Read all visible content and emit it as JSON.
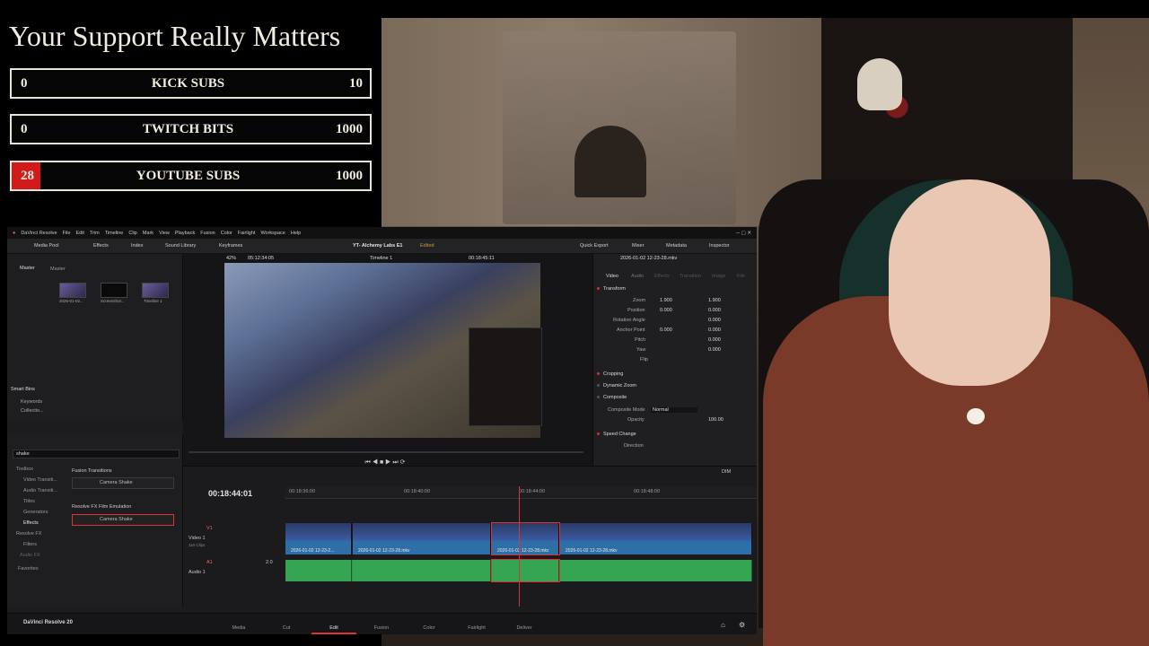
{
  "support": {
    "title": "Your Support Really Matters",
    "accent": "#d11a1a",
    "goals": [
      {
        "current": "0",
        "label": "KICK SUBS",
        "max": "10",
        "progress": 0
      },
      {
        "current": "0",
        "label": "TWITCH BITS",
        "max": "1000",
        "progress": 0
      },
      {
        "current": "28",
        "label": "YOUTUBE SUBS",
        "max": "1000",
        "progress": 0.028
      }
    ]
  },
  "resolve": {
    "menu": [
      "DaVinci Resolve",
      "File",
      "Edit",
      "Trim",
      "Timeline",
      "Clip",
      "Mark",
      "View",
      "Playback",
      "Fusion",
      "Color",
      "Fairlight",
      "Workspace",
      "Help"
    ],
    "toolbar": {
      "media_pool": "Media Pool",
      "effects": "Effects",
      "index": "Index",
      "sound_library": "Sound Library",
      "keyframes": "Keyframes",
      "project_title": "YT- Alchemy Labs E1",
      "edited": "Edited",
      "quick_export": "Quick Export",
      "mixer": "Mixer",
      "metadata": "Metadata",
      "inspector": "Inspector"
    },
    "media_pool": {
      "tabs": [
        "Master",
        "Master"
      ],
      "clips": [
        "2026-01-02...",
        "Screenshot...",
        "Timeline 1"
      ],
      "smart_bins": "Smart Bins",
      "smart_items": [
        "Keywords",
        "Collectio..."
      ]
    },
    "viewer": {
      "zoom": "42%",
      "source_tc": "05:12:34:05",
      "timeline_name": "Timeline 1",
      "record_tc": "00:18:45:11"
    },
    "inspector": {
      "clip_name": "2026-01-02 12-23-28.mkv",
      "tabs": [
        "Video",
        "Audio",
        "Effects",
        "Transition",
        "Image",
        "File"
      ],
      "transform": "Transform",
      "zoom_label": "Zoom",
      "zoom_x": "1.900",
      "zoom_y": "1.900",
      "position_label": "Position",
      "position_x": "0.000",
      "position_y": "0.000",
      "rotation_label": "Rotation Angle",
      "rotation": "0.000",
      "anchor_label": "Anchor Point",
      "anchor_x": "0.000",
      "anchor_y": "0.000",
      "pitch_label": "Pitch",
      "pitch": "0.000",
      "yaw_label": "Yaw",
      "yaw": "0.000",
      "flip_label": "Flip",
      "cropping": "Cropping",
      "dynamic_zoom": "Dynamic Zoom",
      "composite": "Composite",
      "composite_mode_label": "Composite Mode",
      "composite_mode": "Normal",
      "opacity_label": "Opacity",
      "opacity": "100.00",
      "speed_change": "Speed Change",
      "direction_label": "Direction"
    },
    "effects_panel": {
      "search": "shake",
      "tree": [
        "Toolbox",
        "Video Transiti...",
        "Audio Transiti...",
        "Titles",
        "Generators",
        "Effects",
        "Resolve FX",
        "Filters",
        "Audio FX",
        "Favorites"
      ],
      "group1": "Fusion Transitions",
      "item1": "Camera Shake",
      "group2": "Resolve FX Film Emulation",
      "item2": "Camera Shake"
    },
    "timeline": {
      "timecode": "00:18:44:01",
      "ruler": [
        "00:18:36:00",
        "00:18:40:00",
        "00:18:44:00",
        "00:18:48:00"
      ],
      "video_track_id": "V1",
      "video_track_name": "Video 1",
      "video_track_clips": "110 Clips",
      "audio_track_id": "A1",
      "audio_track_name": "Audio 1",
      "audio_level": "2.0",
      "clip_names": [
        "2026-01-02 12-23-2...",
        "2026-01-02 12-23-28.mkv",
        "2026-01-02 12-23-28.mkv",
        "2026-01-02 12-23-28.mkv"
      ],
      "dim": "DIM"
    },
    "pages": [
      "Media",
      "Cut",
      "Edit",
      "Fusion",
      "Color",
      "Fairlight",
      "Deliver"
    ],
    "active_page": "Edit",
    "brand": "DaVinci Resolve 20"
  }
}
